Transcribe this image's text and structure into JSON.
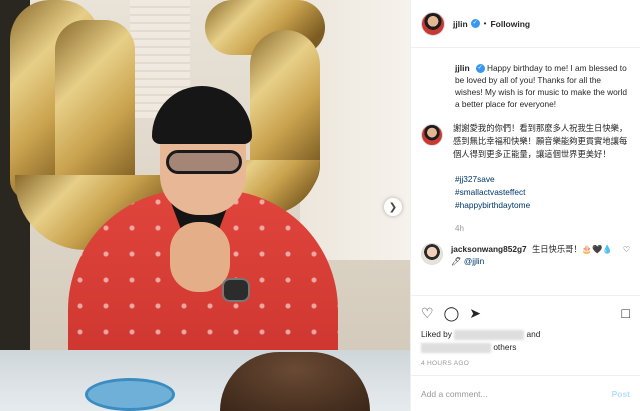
{
  "header": {
    "username": "jjlin",
    "separator": "•",
    "follow_status": "Following"
  },
  "caption": {
    "username": "jjlin",
    "text_en": "Happy birthday to me! I am blessed to be loved by all of you! Thanks for all the wishes! My wish is for music to make the world a better place for everyone!",
    "text_zh": "謝謝愛我的你們！看到那麼多人祝我生日快樂，感到無比幸福和快樂！願音樂能夠更貫實地讓每個人得到更多正能量，讓這個世界更美好！",
    "hashtags": [
      "#jj327save",
      "#smallactvasteffect",
      "#happybirthdaytome"
    ],
    "time_ago": "4h"
  },
  "comment": {
    "username": "jacksonwang852g7",
    "text": "生日快乐哥！🎂🖤💧🖊",
    "mention": "@jjlin"
  },
  "likes": {
    "prefix": "Liked by",
    "conj": "and",
    "suffix": "others"
  },
  "posted": "4 HOURS AGO",
  "add_comment": {
    "placeholder": "Add a comment...",
    "post_label": "Post"
  },
  "icons": {
    "like": "heart-icon",
    "comment": "comment-icon",
    "share": "share-icon",
    "save": "bookmark-icon",
    "next": "chevron-right-icon"
  },
  "colors": {
    "verified": "#3897f0",
    "hashtag": "#003569",
    "post_disabled": "#b2dffc"
  }
}
